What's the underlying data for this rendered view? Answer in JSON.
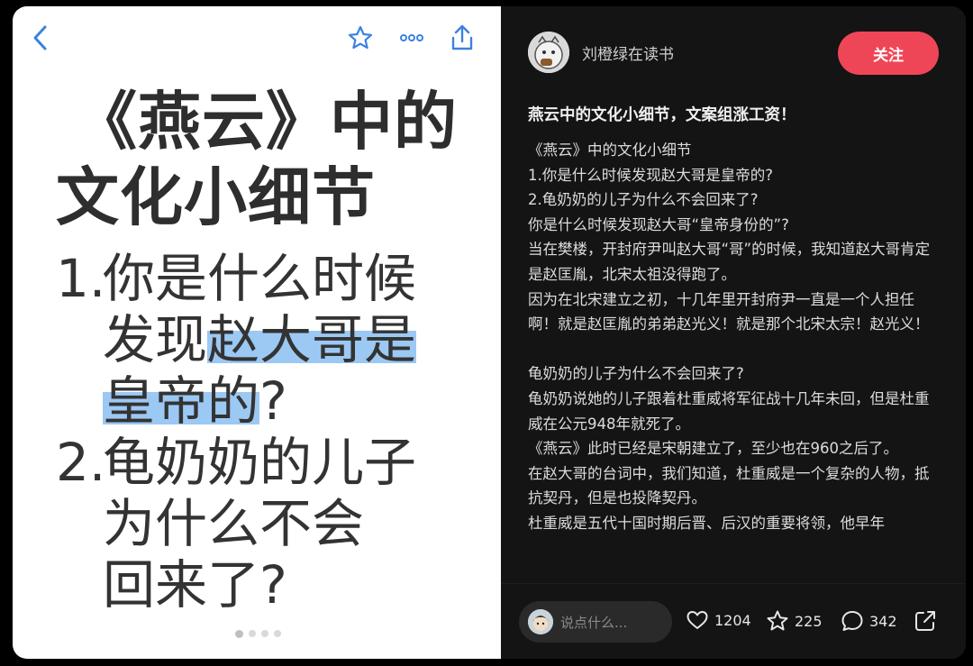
{
  "note_image": {
    "title_line1": "《燕云》中的",
    "title_line2": "文化小细节",
    "q1_num": "1.",
    "q1_line1": "你是什么时候",
    "q1_line2_plain": "发现",
    "q1_line2_hl": "赵大哥是",
    "q1_line3_hl": "皇帝的",
    "q1_line3_end": "?",
    "q2_num": "2.",
    "q2_line1": "龟奶奶的儿子",
    "q2_line2": "为什么不会",
    "q2_line3": "回来了?"
  },
  "author": {
    "name": "刘橙绿在读书"
  },
  "follow_label": "关注",
  "post": {
    "title": "燕云中的文化小细节，文案组涨工资！",
    "lines": [
      "《燕云》中的文化小细节",
      "1.你是什么时候发现赵大哥是皇帝的?",
      "2.龟奶奶的儿子为什么不会回来了?",
      "你是什么时候发现赵大哥“皇帝身份的”?",
      "当在樊楼，开封府尹叫赵大哥“哥”的时候，我知道赵大哥肯定是赵匡胤，北宋太祖没得跑了。",
      "因为在北宋建立之初，十几年里开封府尹一直是一个人担任啊！就是赵匡胤的弟弟赵光义！就是那个北宋太宗！赵光义！",
      "",
      "龟奶奶的儿子为什么不会回来了?",
      "龟奶奶说她的儿子跟着杜重威将军征战十几年未回，但是杜重威在公元948年就死了。",
      "《燕云》此时已经是宋朝建立了，至少也在960之后了。",
      "在赵大哥的台词中，我们知道，杜重威是一个复杂的人物，抵抗契丹，但是也投降契丹。",
      "杜重威是五代十国时期后晋、后汉的重要将领，他早年"
    ]
  },
  "comment_placeholder": "说点什么...",
  "stats": {
    "likes": "1204",
    "collects": "225",
    "comments": "342"
  },
  "colors": {
    "accent": "#ef4657",
    "highlight": "#9cc8f4",
    "icon_blue": "#3b82e0"
  }
}
